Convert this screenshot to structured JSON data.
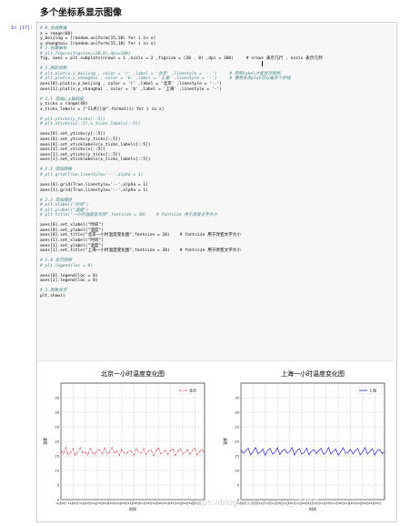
{
  "page": {
    "title": "多个坐标系显示图像"
  },
  "cell": {
    "prompt": "In  [17]:",
    "lines": [
      {
        "t": "# 0.生成数据",
        "k": "com"
      },
      {
        "t": "x = range(60)",
        "k": "code"
      },
      {
        "t": "y_beijing = [random.uniform(15,18) for i in x]",
        "k": "code"
      },
      {
        "t": "y_shanghai= [random.uniform(15,18) for i in x]",
        "k": "code"
      },
      {
        "t": "# 1.创建画布",
        "k": "com"
      },
      {
        "t": "# plt.figure(figsize=(20,8),dpi=100)",
        "k": "com"
      },
      {
        "t": "fig, axes = plt.subplots(nrows = 1 ,ncols = 2 ,figsize = (20 , 8) ,dpi = 100)     # nrows 表示几行 , ncols 表示几列",
        "k": "code"
      },
      {
        "t": "",
        "k": "blank"
      },
      {
        "t": "# 2.图形绘制",
        "k": "com"
      },
      {
        "t": "# plt.plot(x,y_beijing , color = 'r' ,label = '北京' ,linestyle = '-.')     # 声明label才能显示图例",
        "k": "com"
      },
      {
        "t": "# plt.plot(x,y_shanghai , color = 'b' ,label = '上海' ,linestyle = '-')     # 使用多次plot可以画多个折线",
        "k": "com"
      },
      {
        "t": "axes[0].plot(x,y_beijing , color = 'r' ,label = '北京' ,linestyle = '-.')",
        "k": "code"
      },
      {
        "t": "axes[1].plot(x,y_shanghai , color = 'b' ,label = '上海' ,linestyle = '-')",
        "k": "code"
      },
      {
        "t": "",
        "k": "blank"
      },
      {
        "t": "# 2.1 添加x,y轴刻度",
        "k": "com"
      },
      {
        "t": "y_ticks = range(40)",
        "k": "code"
      },
      {
        "t": "x_ticks_labels = [\"11点{}分\".format(i) for i in x]",
        "k": "code"
      },
      {
        "t": "",
        "k": "blank"
      },
      {
        "t": "# plt.yticks(y_ticks[::5])",
        "k": "com"
      },
      {
        "t": "# plt.xticks(x[::5],x_ticks_labels[::5])",
        "k": "com"
      },
      {
        "t": "",
        "k": "blank"
      },
      {
        "t": "axes[0].set_yticks(y[::5])",
        "k": "code"
      },
      {
        "t": "axes[0].set_yticks(y_ticks[::5])",
        "k": "code"
      },
      {
        "t": "axes[0].set_xticklabels(x_ticks_labels[::5])",
        "k": "code"
      },
      {
        "t": "axes[1].set_xticks(x[::5])",
        "k": "code"
      },
      {
        "t": "axes[1].set_yticks(y_ticks[::5])",
        "k": "code"
      },
      {
        "t": "axes[1].set_xticklabels(x_ticks_labels[::5])",
        "k": "code"
      },
      {
        "t": "",
        "k": "blank"
      },
      {
        "t": "# 2.2 添加网格",
        "k": "com"
      },
      {
        "t": "# plt.grid(True,linestyle='--',alpha = 1)",
        "k": "com"
      },
      {
        "t": "",
        "k": "blank"
      },
      {
        "t": "axes[0].grid(True,linestyle='--',alpha = 1)",
        "k": "code"
      },
      {
        "t": "axes[1].grid(True,linestyle='--',alpha = 1)",
        "k": "code"
      },
      {
        "t": "",
        "k": "blank"
      },
      {
        "t": "# 2.3 添加描述",
        "k": "com"
      },
      {
        "t": "# plt.xlabel(\"时间\")",
        "k": "com"
      },
      {
        "t": "# plt.ylabel(\"温度\")",
        "k": "com"
      },
      {
        "t": "# plt.title(\"一小时温度变化图\",fontsize = 20)    # fontsize 用于改变文字大小",
        "k": "com"
      },
      {
        "t": "",
        "k": "blank"
      },
      {
        "t": "axes[0].set_xlabel(\"时间\")",
        "k": "code"
      },
      {
        "t": "axes[0].set_ylabel(\"温度\")",
        "k": "code"
      },
      {
        "t": "axes[0].set_title(\"北京一小时温度变化图\",fontsize = 20)    # fontsize 用于改变文字大小",
        "k": "code"
      },
      {
        "t": "axes[1].set_xlabel(\"时间\")",
        "k": "code"
      },
      {
        "t": "axes[1].set_ylabel(\"温度\")",
        "k": "code"
      },
      {
        "t": "axes[1].set_title(\"上海一小时温度变化图\",fontsize = 20)    # fontsize 用于改变文字大小",
        "k": "code"
      },
      {
        "t": "",
        "k": "blank"
      },
      {
        "t": "# 2.4 显示图例",
        "k": "com"
      },
      {
        "t": "# plt.legend(loc = 0)",
        "k": "com"
      },
      {
        "t": "",
        "k": "blank"
      },
      {
        "t": "axes[0].legend(loc = 0)",
        "k": "code"
      },
      {
        "t": "axes[1].legend(loc = 0)",
        "k": "code"
      },
      {
        "t": "",
        "k": "blank"
      },
      {
        "t": "# 3.图像显示",
        "k": "com"
      },
      {
        "t": "plt.show()",
        "k": "code"
      }
    ]
  },
  "watermark": "https://blog.csdn.net/qq_42737",
  "chart_data": [
    {
      "type": "line",
      "title": "北京一小时温度变化图",
      "xlabel": "时间",
      "ylabel": "温度",
      "legend_position": "top-right",
      "grid": true,
      "ylim": [
        0,
        40
      ],
      "y_ticks": [
        0,
        5,
        10,
        15,
        20,
        25,
        30,
        35
      ],
      "x_ticks": [
        0,
        5,
        10,
        15,
        20,
        25,
        30,
        35,
        40,
        45,
        50,
        55
      ],
      "x_tick_labels": [
        "11点0分",
        "11点5分",
        "11点10分",
        "11点15分",
        "11点20分",
        "11点25分",
        "11点30分",
        "11点35分",
        "11点40分",
        "11点45分",
        "11点50分",
        "11点55分"
      ],
      "series": [
        {
          "name": "北京",
          "color": "#d62728",
          "linestyle": "-.",
          "x": [
            0,
            1,
            2,
            3,
            4,
            5,
            6,
            7,
            8,
            9,
            10,
            11,
            12,
            13,
            14,
            15,
            16,
            17,
            18,
            19,
            20,
            21,
            22,
            23,
            24,
            25,
            26,
            27,
            28,
            29,
            30,
            31,
            32,
            33,
            34,
            35,
            36,
            37,
            38,
            39,
            40,
            41,
            42,
            43,
            44,
            45,
            46,
            47,
            48,
            49,
            50,
            51,
            52,
            53,
            54,
            55,
            56,
            57,
            58,
            59
          ],
          "values": [
            16.8,
            15.6,
            17.9,
            15.3,
            16.2,
            17.5,
            15.1,
            16.6,
            17.8,
            15.9,
            16.4,
            15.2,
            17.6,
            16.1,
            15.4,
            17.2,
            16.9,
            15.7,
            17.7,
            15.5,
            16.3,
            17.9,
            15.8,
            16.7,
            15.2,
            17.4,
            16.0,
            15.6,
            17.1,
            16.5,
            15.3,
            17.8,
            16.2,
            15.9,
            17.5,
            15.4,
            16.8,
            17.3,
            15.1,
            16.6,
            17.9,
            15.7,
            16.3,
            17.0,
            15.5,
            16.9,
            17.6,
            15.2,
            16.4,
            17.7,
            15.8,
            16.1,
            17.2,
            15.6,
            16.7,
            17.9,
            15.3,
            16.5,
            17.4,
            15.9
          ]
        }
      ]
    },
    {
      "type": "line",
      "title": "上海一小时温度变化图",
      "xlabel": "时间",
      "ylabel": "温度",
      "legend_position": "top-right",
      "grid": true,
      "ylim": [
        0,
        40
      ],
      "y_ticks": [
        0,
        5,
        10,
        15,
        20,
        25,
        30,
        35
      ],
      "x_ticks": [
        0,
        5,
        10,
        15,
        20,
        25,
        30,
        35,
        40,
        45,
        50,
        55
      ],
      "x_tick_labels": [
        "11点0分",
        "11点5分",
        "11点10分",
        "11点15分",
        "11点20分",
        "11点25分",
        "11点30分",
        "11点35分",
        "11点40分",
        "11点45分",
        "11点50分",
        "11点55分"
      ],
      "series": [
        {
          "name": "上海",
          "color": "#1f1fcf",
          "linestyle": "-",
          "x": [
            0,
            1,
            2,
            3,
            4,
            5,
            6,
            7,
            8,
            9,
            10,
            11,
            12,
            13,
            14,
            15,
            16,
            17,
            18,
            19,
            20,
            21,
            22,
            23,
            24,
            25,
            26,
            27,
            28,
            29,
            30,
            31,
            32,
            33,
            34,
            35,
            36,
            37,
            38,
            39,
            40,
            41,
            42,
            43,
            44,
            45,
            46,
            47,
            48,
            49,
            50,
            51,
            52,
            53,
            54,
            55,
            56,
            57,
            58,
            59
          ],
          "values": [
            17.2,
            15.9,
            16.8,
            17.7,
            15.4,
            16.5,
            17.9,
            15.8,
            16.3,
            17.4,
            15.2,
            16.9,
            17.6,
            15.6,
            16.2,
            17.8,
            15.5,
            16.7,
            17.3,
            15.9,
            16.4,
            17.9,
            15.3,
            16.8,
            17.5,
            15.7,
            16.1,
            17.7,
            15.4,
            16.6,
            17.2,
            15.8,
            16.9,
            17.6,
            15.5,
            16.3,
            17.9,
            15.6,
            16.7,
            17.4,
            15.2,
            16.5,
            17.8,
            15.9,
            16.2,
            17.3,
            15.7,
            16.8,
            17.6,
            15.4,
            16.4,
            17.9,
            15.6,
            16.6,
            17.5,
            15.3,
            16.9,
            17.2,
            15.8,
            16.4
          ]
        }
      ]
    }
  ]
}
